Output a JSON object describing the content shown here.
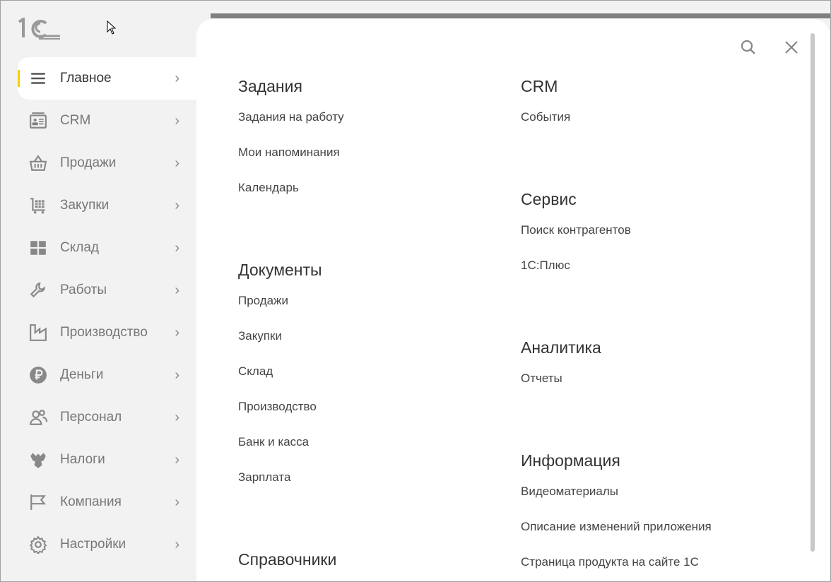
{
  "sidebar": {
    "items": [
      {
        "label": "Главное",
        "icon": "menu-icon",
        "active": true
      },
      {
        "label": "CRM",
        "icon": "contact-card-icon"
      },
      {
        "label": "Продажи",
        "icon": "basket-icon"
      },
      {
        "label": "Закупки",
        "icon": "cart-icon"
      },
      {
        "label": "Склад",
        "icon": "warehouse-icon"
      },
      {
        "label": "Работы",
        "icon": "wrench-icon"
      },
      {
        "label": "Производство",
        "icon": "factory-icon"
      },
      {
        "label": "Деньги",
        "icon": "ruble-icon"
      },
      {
        "label": "Персонал",
        "icon": "people-icon"
      },
      {
        "label": "Налоги",
        "icon": "eagle-icon"
      },
      {
        "label": "Компания",
        "icon": "flag-icon"
      },
      {
        "label": "Настройки",
        "icon": "gear-icon"
      }
    ]
  },
  "accent": "#f5d000",
  "left": [
    {
      "title": "Задания",
      "links": [
        "Задания на работу",
        "Мои напоминания",
        "Календарь"
      ]
    },
    {
      "title": "Документы",
      "links": [
        "Продажи",
        "Закупки",
        "Склад",
        "Производство",
        "Банк и касса",
        "Зарплата"
      ]
    },
    {
      "title": "Справочники",
      "links": []
    }
  ],
  "right": [
    {
      "title": "CRM",
      "links": [
        "События"
      ]
    },
    {
      "title": "Сервис",
      "links": [
        "Поиск контрагентов",
        "1С:Плюс"
      ]
    },
    {
      "title": "Аналитика",
      "links": [
        "Отчеты"
      ]
    },
    {
      "title": "Информация",
      "links": [
        "Видеоматериалы",
        "Описание изменений приложения",
        "Страница продукта на сайте 1С"
      ]
    }
  ]
}
